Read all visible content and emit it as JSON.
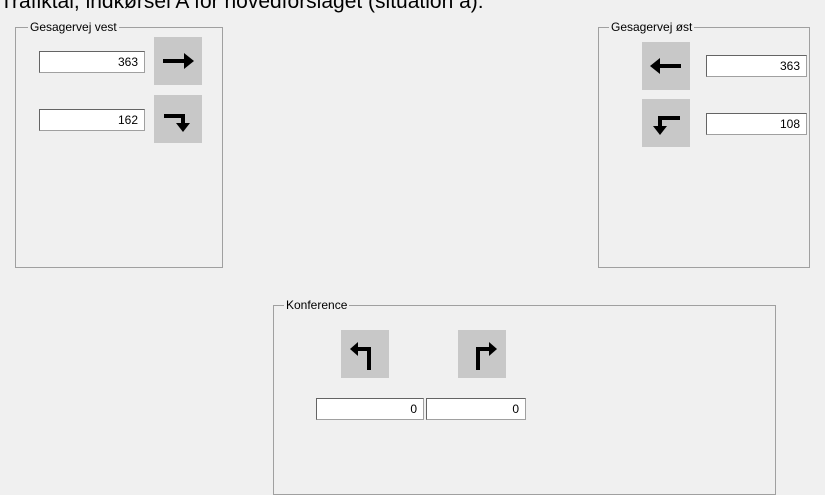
{
  "window": {
    "caption": "Trafiktal, indkørsel A for hovedforslaget (situation a):"
  },
  "groups": {
    "west": {
      "title": "Gesagervej vest",
      "straight_value": "363",
      "right_value": "162",
      "straight_icon": "arrow-straight-right-icon",
      "turn_icon": "arrow-turn-right-icon"
    },
    "east": {
      "title": "Gesagervej øst",
      "straight_value": "363",
      "left_value": "108",
      "straight_icon": "arrow-straight-left-icon",
      "turn_icon": "arrow-turn-left-icon"
    },
    "conference": {
      "title": "Konference",
      "left_value": "0",
      "right_value": "0",
      "left_icon": "arrow-up-turn-left-icon",
      "right_icon": "arrow-up-turn-right-icon"
    }
  }
}
